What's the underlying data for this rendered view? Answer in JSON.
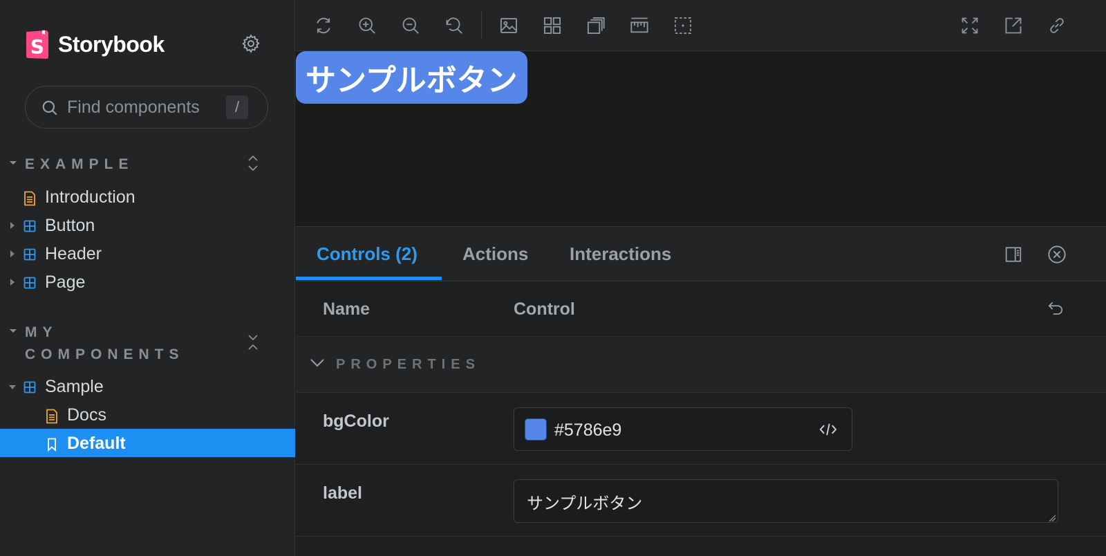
{
  "app": {
    "brand": "Storybook",
    "colors": {
      "accent": "#1e8ff2",
      "logo_pink": "#ff4785",
      "doc_icon": "#f0a33a",
      "component_icon": "#2d9bf0"
    }
  },
  "sidebar": {
    "search": {
      "placeholder": "Find components",
      "shortcut": "/"
    },
    "groups": [
      {
        "title": "EXAMPLE",
        "items": [
          {
            "label": "Introduction",
            "icon": "document-icon"
          },
          {
            "label": "Button",
            "icon": "component-icon"
          },
          {
            "label": "Header",
            "icon": "component-icon"
          },
          {
            "label": "Page",
            "icon": "component-icon"
          }
        ]
      },
      {
        "title": "MY COMPONENTS",
        "items": [
          {
            "label": "Sample",
            "icon": "component-icon"
          },
          {
            "label": "Docs",
            "icon": "document-icon"
          },
          {
            "label": "Default",
            "icon": "bookmark-icon",
            "selected": true
          }
        ]
      }
    ]
  },
  "toolbar": {
    "left_tools": [
      "remount-icon",
      "zoom-in-icon",
      "zoom-out-icon",
      "zoom-reset-icon",
      "background-icon",
      "grid-icon",
      "viewport-icon",
      "measure-icon",
      "outline-icon"
    ],
    "right_tools": [
      "fullscreen-icon",
      "open-new-tab-icon",
      "copy-link-icon"
    ]
  },
  "canvas": {
    "button_label": "サンプルボタン",
    "button_bg": "#5786e9"
  },
  "panel": {
    "tabs": [
      {
        "label": "Controls (2)",
        "active": true
      },
      {
        "label": "Actions",
        "active": false
      },
      {
        "label": "Interactions",
        "active": false
      }
    ],
    "table": {
      "headers": {
        "name": "Name",
        "control": "Control"
      },
      "section": "PROPERTIES",
      "rows": [
        {
          "name": "bgColor",
          "value": "#5786e9"
        },
        {
          "name": "label",
          "value": "サンプルボタン"
        }
      ]
    }
  }
}
